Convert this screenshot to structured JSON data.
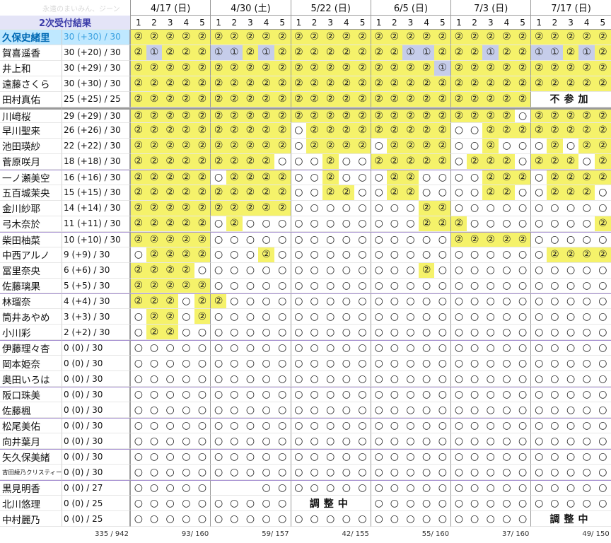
{
  "title": "永遠のまいみん、ジーン",
  "result_label": "2次受付結果",
  "dates": [
    "4/17 (日)",
    "4/30 (土)",
    "5/22 (日)",
    "6/5 (日)",
    "7/3 (日)",
    "7/17 (日)"
  ],
  "parts": [
    "1",
    "2",
    "3",
    "4",
    "5"
  ],
  "members": [
    {
      "name": "久保史緒里",
      "score": "30 (+30) / 30",
      "cells": "222222222222222222222222222222",
      "highlight": true
    },
    {
      "name": "賀喜遥香",
      "score": "30 (+20) / 30",
      "cells": "212221121222222221122212211212"
    },
    {
      "name": "井上和",
      "score": "30 (+29) / 30",
      "cells": "222222222222222222212222222222"
    },
    {
      "name": "遠藤さくら",
      "score": "30 (+30) / 30",
      "cells": "222222222222222222222222222222"
    },
    {
      "name": "田村真佑",
      "score": "25 (+25) / 25",
      "cells": "2222222222222222222222222-----"
    },
    {
      "name": "川﨑桜",
      "score": "29 (+29) / 30",
      "cells": "222222222222222222222222022222"
    },
    {
      "name": "早川聖来",
      "score": "26 (+26) / 30",
      "cells": "222222222202222222220022222222"
    },
    {
      "name": "池田瑛紗",
      "score": "22 (+22) / 30",
      "cells": "222222222202222022220020002022"
    },
    {
      "name": "菅原咲月",
      "score": "18 (+18) / 30",
      "cells": "222222222000200222220222022202"
    },
    {
      "name": "一ノ瀬美空",
      "score": "16 (+16) / 30",
      "cells": "222220222200200022000022202222"
    },
    {
      "name": "五百城茉央",
      "score": "15 (+15) / 30",
      "cells": "222222222200220022000022002220"
    },
    {
      "name": "金川紗耶",
      "score": "14 (+14) / 30",
      "cells": "222222222200000000220000000000"
    },
    {
      "name": "弓木奈於",
      "score": "11 (+11) / 30",
      "cells": "222220200000000000222000000002"
    },
    {
      "name": "柴田柚菜",
      "score": "10 (+10) / 30",
      "cells": "222220000000000000002222200000"
    },
    {
      "name": "中西アルノ",
      "score": "9 (+9) / 30",
      "cells": "022220002000000000000000002222"
    },
    {
      "name": "冨里奈央",
      "score": "6 (+6) / 30",
      "cells": "222200000000000000200000000000"
    },
    {
      "name": "佐藤璃果",
      "score": "5 (+5) / 30",
      "cells": "222220000000000000000000000000"
    },
    {
      "name": "林瑠奈",
      "score": "4 (+4) / 30",
      "cells": "222022000000000000000000000000"
    },
    {
      "name": "筒井あやめ",
      "score": "3 (+3) / 30",
      "cells": "022020000000000000000000000000"
    },
    {
      "name": "小川彩",
      "score": "2 (+2) / 30",
      "cells": "022000000000000000000000000000"
    },
    {
      "name": "伊藤理々杏",
      "score": "0 (0) / 30",
      "cells": "000000000000000000000000000000"
    },
    {
      "name": "岡本姫奈",
      "score": "0 (0) / 30",
      "cells": "000000000000000000000000000000"
    },
    {
      "name": "奥田いろは",
      "score": "0 (0) / 30",
      "cells": "000000000000000000000000000000"
    },
    {
      "name": "阪口珠美",
      "score": "0 (0) / 30",
      "cells": "000000000000000000000000000000"
    },
    {
      "name": "佐藤楓",
      "score": "0 (0) / 30",
      "cells": "000000000000000000000000000000"
    },
    {
      "name": "松尾美佑",
      "score": "0 (0) / 30",
      "cells": "000000000000000000000000000000"
    },
    {
      "name": "向井葉月",
      "score": "0 (0) / 30",
      "cells": "000000000000000000000000000000"
    },
    {
      "name": "矢久保美緒",
      "score": "0 (0) / 30",
      "cells": "000000000000000000000000000000"
    },
    {
      "name": "吉田綾乃クリスティー",
      "score": "0 (0) / 30",
      "cells": "000000000000000000000000000000",
      "small": true
    },
    {
      "name": "黒見明香",
      "score": "0 (0) / 27",
      "cells": "00000---0000000000000000000000"
    },
    {
      "name": "北川悠理",
      "score": "0 (0) / 25",
      "cells": "0000000000-----000000000000000"
    },
    {
      "name": "中村麗乃",
      "score": "0 (0) / 25",
      "cells": "0000000000000000000000000-----"
    }
  ],
  "span_labels": [
    {
      "row": 4,
      "text": "不参加"
    },
    {
      "row": 30,
      "text": "調整中"
    },
    {
      "row": 31,
      "text": "調整中"
    }
  ],
  "totals": [
    "335 / 942",
    "93/ 160",
    "59/ 157",
    "42/ 155",
    "55/ 160",
    "37/ 160",
    "49/ 150"
  ],
  "symbols": {
    "2": "②",
    "1": "①",
    "0": "○",
    "-": ""
  },
  "colors": {
    "win": "#f5f26a",
    "partial": "#c6cdea",
    "highlight_name": "#bfe8ff"
  }
}
